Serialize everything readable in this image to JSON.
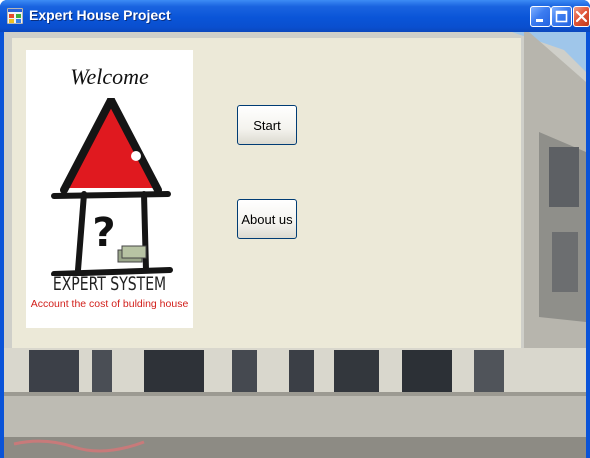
{
  "window": {
    "title": "Expert House Project",
    "app_icon": "windows-form-icon",
    "controls": [
      "minimize-icon",
      "maximize-icon",
      "close-icon"
    ]
  },
  "logo": {
    "welcome": "Welcome",
    "brand": "EXPERT SYSTEM",
    "tagline": "Account the cost of bulding house",
    "icon": "house-question-icon"
  },
  "buttons": {
    "start": "Start",
    "about": "About us"
  },
  "colors": {
    "titlebar": "#0a55d8",
    "panel": "#ece9d8",
    "roof_red": "#e0191f",
    "tagline_red": "#d2201c"
  }
}
